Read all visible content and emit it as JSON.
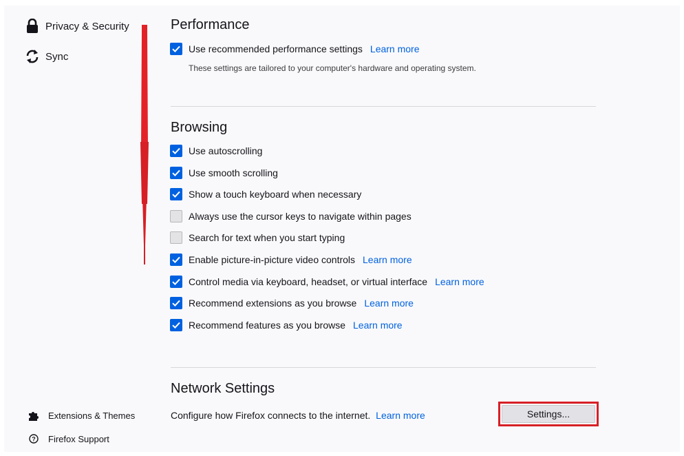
{
  "sidebar": {
    "privacy_label": "Privacy & Security",
    "sync_label": "Sync",
    "extensions_label": "Extensions & Themes",
    "support_label": "Firefox Support"
  },
  "performance": {
    "title": "Performance",
    "recommended": {
      "label": "Use recommended performance settings",
      "checked": true,
      "link": "Learn more"
    },
    "description": "These settings are tailored to your computer's hardware and operating system."
  },
  "browsing": {
    "title": "Browsing",
    "items": [
      {
        "label": "Use autoscrolling",
        "checked": true,
        "link": ""
      },
      {
        "label": "Use smooth scrolling",
        "checked": true,
        "link": ""
      },
      {
        "label": "Show a touch keyboard when necessary",
        "checked": true,
        "link": ""
      },
      {
        "label": "Always use the cursor keys to navigate within pages",
        "checked": false,
        "link": ""
      },
      {
        "label": "Search for text when you start typing",
        "checked": false,
        "link": ""
      },
      {
        "label": "Enable picture-in-picture video controls",
        "checked": true,
        "link": "Learn more"
      },
      {
        "label": "Control media via keyboard, headset, or virtual interface",
        "checked": true,
        "link": "Learn more"
      },
      {
        "label": "Recommend extensions as you browse",
        "checked": true,
        "link": "Learn more"
      },
      {
        "label": "Recommend features as you browse",
        "checked": true,
        "link": "Learn more"
      }
    ]
  },
  "network": {
    "title": "Network Settings",
    "description": "Configure how Firefox connects to the internet.",
    "link": "Learn more",
    "button": "Settings..."
  },
  "colors": {
    "accent": "#0061e0",
    "highlight": "#d71f26"
  }
}
